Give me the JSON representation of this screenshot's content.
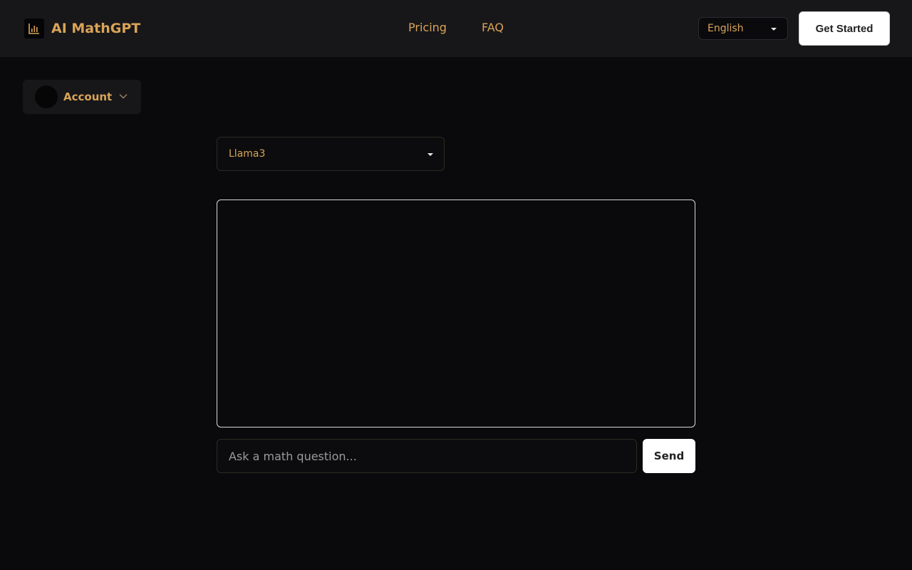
{
  "header": {
    "logo_text": "AI MathGPT",
    "nav": [
      {
        "label": "Pricing"
      },
      {
        "label": "FAQ"
      }
    ],
    "language": "English",
    "get_started_label": "Get Started"
  },
  "account": {
    "label": "Account"
  },
  "model": {
    "selected": "Llama3"
  },
  "chat": {
    "placeholder": "Ask a math question...",
    "send_label": "Send"
  },
  "colors": {
    "accent": "#d9a456",
    "background": "#0a0a0c",
    "header_bg": "#17171a"
  }
}
